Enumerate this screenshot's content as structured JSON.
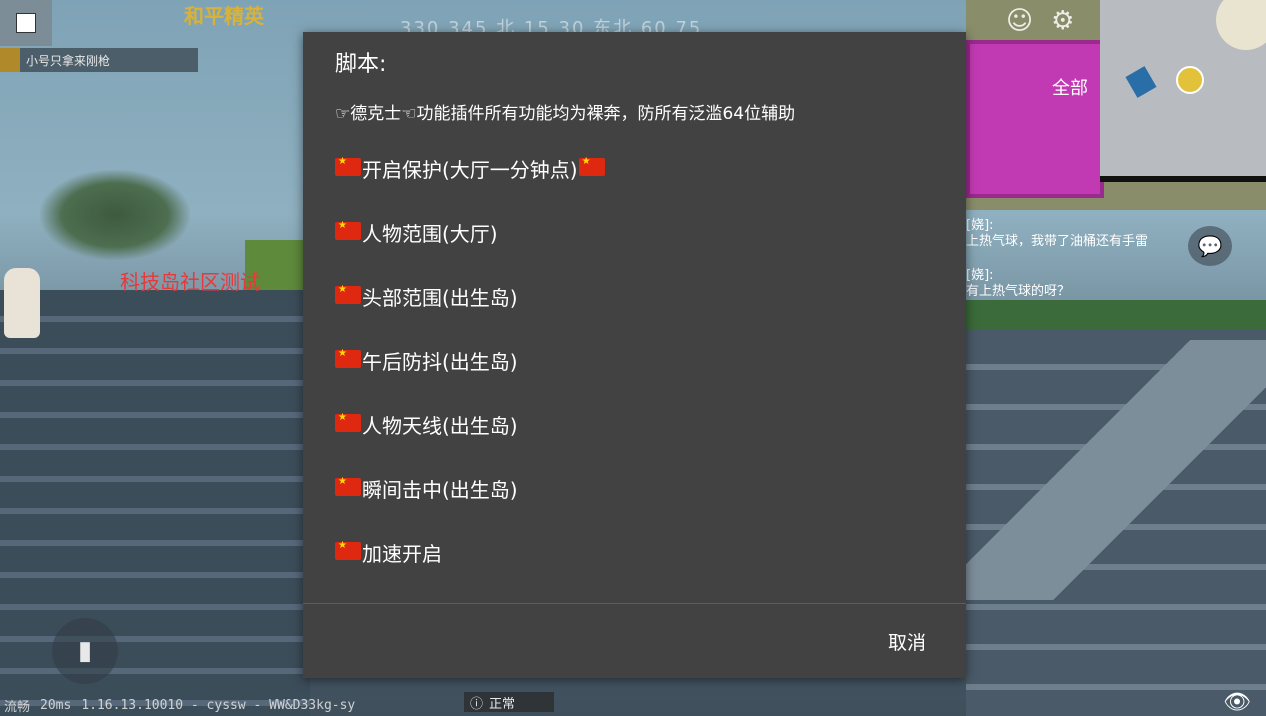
{
  "hud": {
    "game_title": "和平精英",
    "compass": "330 345 北 15 30 东北 60 75",
    "team_label": "小号只拿来刚枪",
    "watermark": "科技岛社区测试",
    "full_label": "全部",
    "chat": [
      {
        "sender": "[娆]:",
        "text": "上热气球，我带了油桶还有手雷"
      },
      {
        "sender": "[娆]:",
        "text": "有上热气球的呀？"
      }
    ],
    "status_left": [
      "流畅",
      "20ms",
      "1.16.13.10010 - cyssw - WW&D33kg-sy"
    ],
    "status_mid": "正常"
  },
  "dialog": {
    "title": "脚本:",
    "subtitle": "☞德克士☜功能插件所有功能均为裸奔，防所有泛滥64位辅助",
    "items": [
      {
        "label": "开启保护(大厅一分钟点)",
        "trailing_flag": true
      },
      {
        "label": "人物范围(大厅)",
        "trailing_flag": false
      },
      {
        "label": "头部范围(出生岛)",
        "trailing_flag": false
      },
      {
        "label": "午后防抖(出生岛)",
        "trailing_flag": false
      },
      {
        "label": "人物天线(出生岛)",
        "trailing_flag": false
      },
      {
        "label": "瞬间击中(出生岛)",
        "trailing_flag": false
      },
      {
        "label": "加速开启",
        "trailing_flag": false
      }
    ],
    "cancel_label": "取消"
  },
  "icons": {
    "flag": "china-flag-icon",
    "eye": "eye-icon",
    "chat": "chat-bubble-icon",
    "bag": "backpack-icon"
  },
  "colors": {
    "dialog_bg": "#424242",
    "flag_red": "#de2910",
    "flag_star": "#ffde00",
    "watermark": "#e8383a"
  }
}
